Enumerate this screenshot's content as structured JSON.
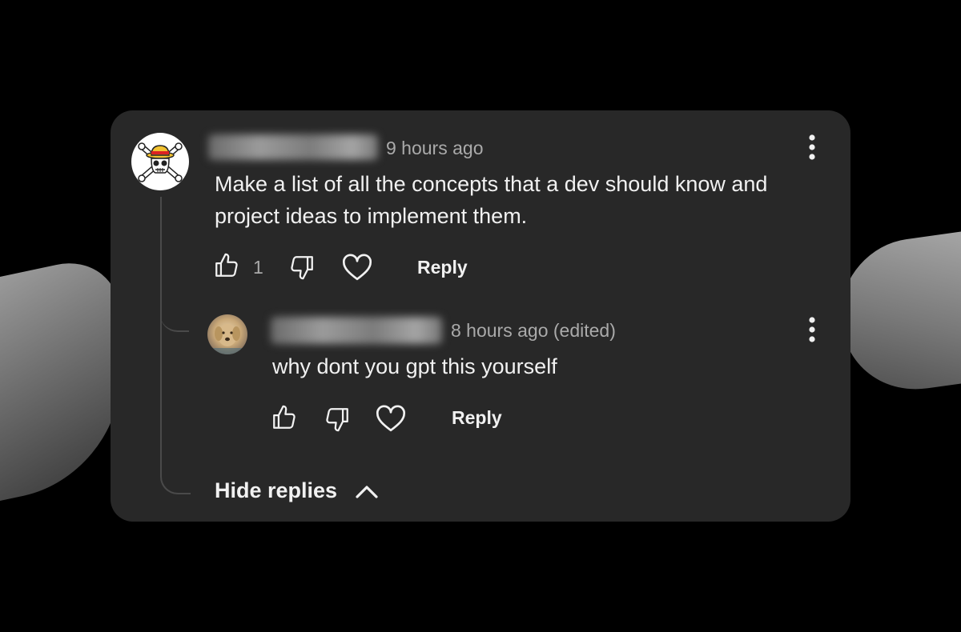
{
  "comment": {
    "timestamp": "9 hours ago",
    "text": "Make a list of all the concepts that a dev should know and project ideas to implement them.",
    "like_count": "1",
    "reply_label": "Reply"
  },
  "reply": {
    "timestamp": "8 hours ago (edited)",
    "text": "why dont you gpt this yourself",
    "reply_label": "Reply"
  },
  "thread": {
    "hide_replies_label": "Hide replies"
  },
  "icons": {
    "like": "thumbs-up-icon",
    "dislike": "thumbs-down-icon",
    "heart": "heart-icon",
    "more": "more-vertical-icon",
    "chevron": "chevron-up-icon"
  },
  "colors": {
    "card_bg": "#282828",
    "text_primary": "#f1f1f1",
    "text_secondary": "#aaaaaa"
  }
}
